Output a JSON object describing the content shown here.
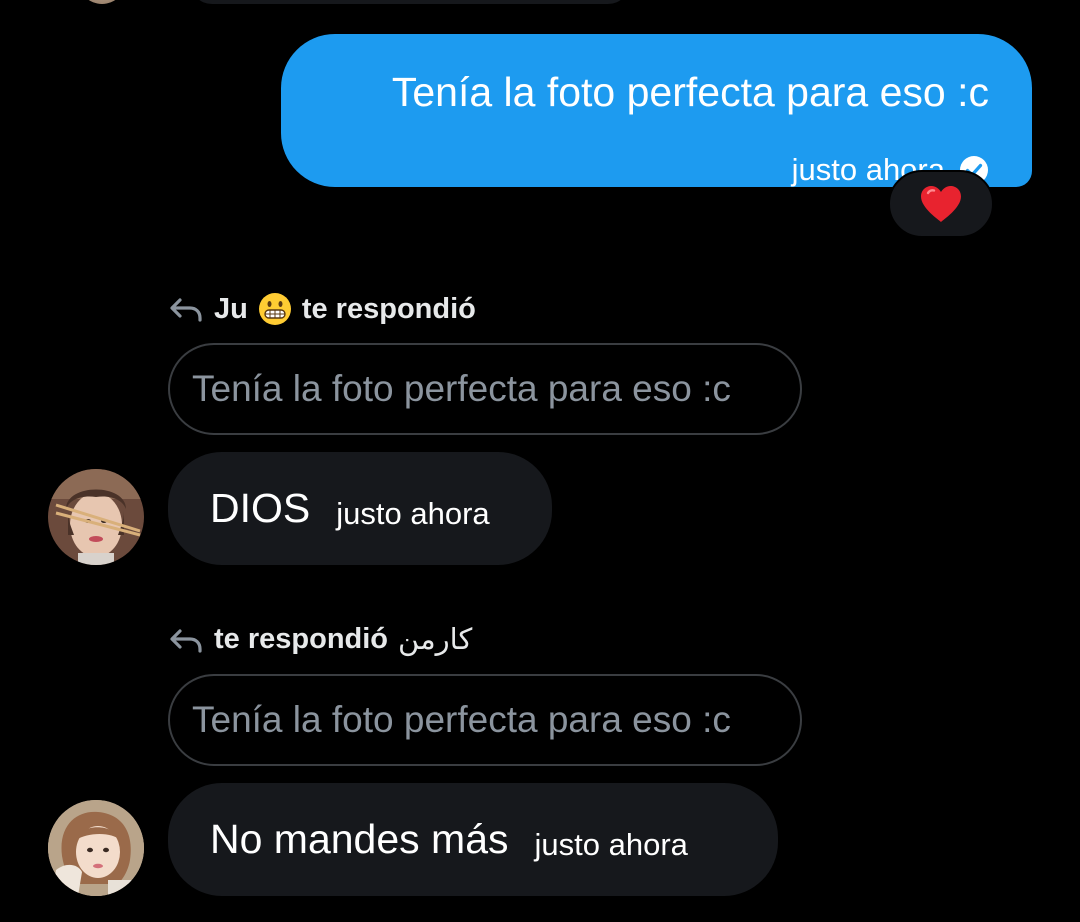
{
  "sent_message": {
    "text": "Tenía la foto perfecta para eso :c",
    "timestamp": "justo ahora",
    "status_icon": "check-circle-icon",
    "reaction": "heart-icon"
  },
  "replies": [
    {
      "header_name": "Ju",
      "header_emoji": "grinning-face-icon",
      "header_suffix": "te respondió",
      "quoted_text": "Tenía la foto perfecta para eso :c",
      "message_text": "DIOS",
      "timestamp": "justo ahora",
      "avatar": "avatar-boy-chopsticks"
    },
    {
      "header_suffix": "te respondió",
      "header_name": "كارمن",
      "quoted_text": "Tenía la foto perfecta para eso :c",
      "message_text": "No mandes más",
      "timestamp": "justo ahora",
      "avatar": "avatar-girl"
    }
  ],
  "colors": {
    "background": "#000000",
    "sent_bubble": "#1d9bf0",
    "received_bubble": "#16181c",
    "quote_border": "#3a3d41",
    "muted_text": "#8b949e"
  }
}
